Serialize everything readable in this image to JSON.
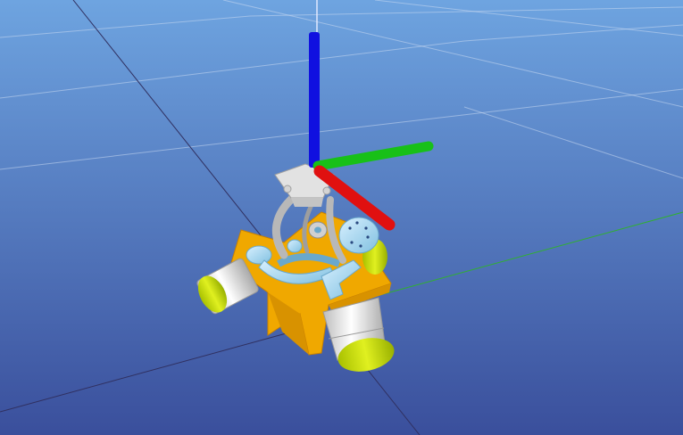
{
  "viewport": {
    "background_top": "#6ea4e0",
    "background_bottom": "#3a4f9c",
    "grid_color": "#c8d8f0",
    "axis_x_color": "#e01010",
    "axis_y_color": "#18c018",
    "axis_z_color": "#1010e0",
    "floor_y_axis_line_color": "#30b030",
    "floor_x_axis_line_color": "#303060"
  },
  "model": {
    "base_color": "#f0a800",
    "motor_housing_color": "#e8e8e8",
    "motor_cap_color": "#c8e000",
    "link_color": "#a8d8f0",
    "arch_color": "#b8b8b8"
  }
}
